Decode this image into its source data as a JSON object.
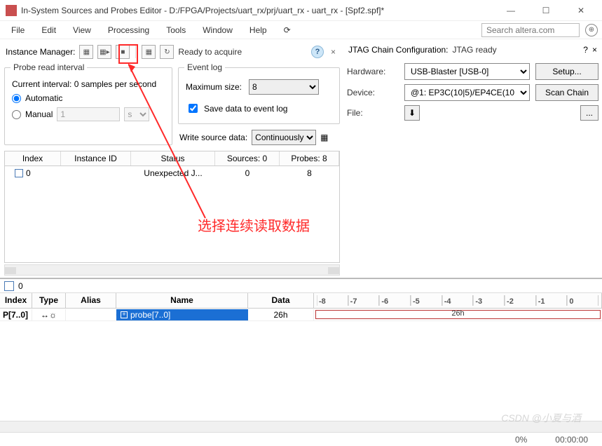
{
  "window": {
    "title": "In-System Sources and Probes Editor - D:/FPGA/Projects/uart_rx/prj/uart_rx - uart_rx - [Spf2.spf]*",
    "min": "—",
    "max": "☐",
    "close": "✕"
  },
  "menu": {
    "file": "File",
    "edit": "Edit",
    "view": "View",
    "processing": "Processing",
    "tools": "Tools",
    "window": "Window",
    "help": "Help"
  },
  "search": {
    "placeholder": "Search altera.com"
  },
  "instance_manager": {
    "label": "Instance Manager:",
    "status": "Ready to acquire"
  },
  "probe_interval": {
    "legend": "Probe read interval",
    "current_label": "Current interval:",
    "current_value": "0 samples per second",
    "automatic": "Automatic",
    "manual": "Manual",
    "manual_val": "1",
    "manual_unit": "s"
  },
  "event_log": {
    "legend": "Event log",
    "max_label": "Maximum size:",
    "max_value": "8",
    "save_label": "Save data to event log"
  },
  "write_source": {
    "label": "Write source data:",
    "value": "Continuously"
  },
  "grid": {
    "headers": {
      "index": "Index",
      "instance_id": "Instance ID",
      "status": "Status",
      "sources": "Sources: 0",
      "probes": "Probes: 8"
    },
    "row": {
      "index": "0",
      "instance_id": "",
      "status": "Unexpected J...",
      "sources": "0",
      "probes": "8"
    }
  },
  "jtag": {
    "title": "JTAG Chain Configuration:",
    "status": "JTAG ready",
    "hardware_label": "Hardware:",
    "hardware_value": "USB-Blaster [USB-0]",
    "setup": "Setup...",
    "device_label": "Device:",
    "device_value": "@1: EP3C(10|5)/EP4CE(10",
    "scan": "Scan Chain",
    "file_label": "File:",
    "browse": "..."
  },
  "bottom": {
    "tab": "0",
    "headers": {
      "index": "Index",
      "type": "Type",
      "alias": "Alias",
      "name": "Name",
      "data": "Data"
    },
    "ticks": [
      "-8",
      "-7",
      "-6",
      "-5",
      "-4",
      "-3",
      "-2",
      "-1",
      "0"
    ],
    "row": {
      "index": "P[7..0]",
      "name": "probe[7..0]",
      "data": "26h",
      "wave": "26h"
    }
  },
  "statusbar": {
    "pct": "0%",
    "time": "00:00:00"
  },
  "annotation": "选择连续读取数据",
  "watermark": "CSDN @小夏与酒"
}
